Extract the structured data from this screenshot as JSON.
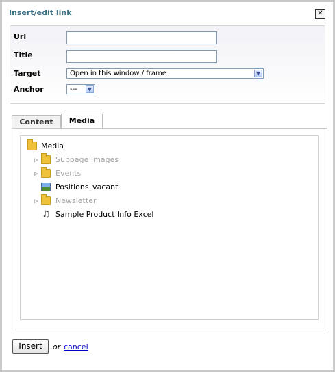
{
  "dialog": {
    "title": "Insert/edit link",
    "close_glyph": "✕"
  },
  "form": {
    "url_label": "Url",
    "url_value": "",
    "title_label": "Title",
    "title_value": "",
    "target_label": "Target",
    "target_value": "Open in this window / frame",
    "anchor_label": "Anchor",
    "anchor_value": "---"
  },
  "tabs": [
    {
      "label": "Content",
      "active": false
    },
    {
      "label": "Media",
      "active": true
    }
  ],
  "tree": {
    "root": {
      "label": "Media",
      "icon": "folder-icon"
    },
    "items": [
      {
        "label": "Subpage Images",
        "icon": "folder-icon",
        "expandable": true,
        "disabled": true
      },
      {
        "label": "Events",
        "icon": "folder-icon",
        "expandable": true,
        "disabled": true
      },
      {
        "label": "Positions_vacant",
        "icon": "image-file-icon",
        "expandable": false,
        "disabled": false
      },
      {
        "label": "Newsletter",
        "icon": "folder-icon",
        "expandable": true,
        "disabled": true
      },
      {
        "label": "Sample Product Info Excel",
        "icon": "music-file-icon",
        "expandable": false,
        "disabled": false
      }
    ]
  },
  "actions": {
    "insert_label": "Insert",
    "or_text": "or",
    "cancel_label": "cancel"
  },
  "colors": {
    "title": "#3c6f84",
    "link": "#0000cc",
    "disabled_text": "#a3a3a3",
    "folder": "#f0c13b"
  }
}
